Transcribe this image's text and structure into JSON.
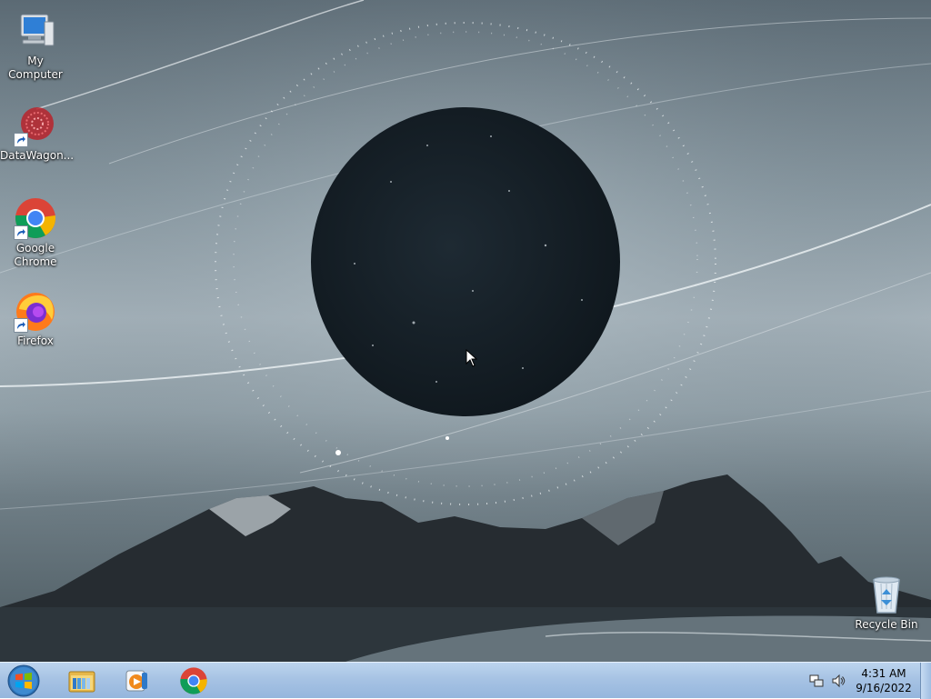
{
  "desktop": {
    "icons": [
      {
        "label": "My Computer",
        "icon": "computer-icon"
      },
      {
        "label": "DataWagon...",
        "icon": "datawagon-icon",
        "shortcut": true
      },
      {
        "label": "Google Chrome",
        "icon": "chrome-icon",
        "shortcut": true
      },
      {
        "label": "Firefox",
        "icon": "firefox-icon",
        "shortcut": true
      },
      {
        "label": "Recycle Bin",
        "icon": "recycle-bin-icon"
      }
    ]
  },
  "taskbar": {
    "start": {
      "icon": "windows-start-icon"
    },
    "pinned": [
      {
        "name": "Windows Explorer",
        "icon": "folder-icon"
      },
      {
        "name": "Windows Media Player",
        "icon": "media-player-icon"
      },
      {
        "name": "Google Chrome",
        "icon": "chrome-icon"
      }
    ],
    "tray": {
      "icons": [
        "network-icon",
        "volume-icon"
      ],
      "time": "4:31 AM",
      "date": "9/16/2022"
    }
  }
}
